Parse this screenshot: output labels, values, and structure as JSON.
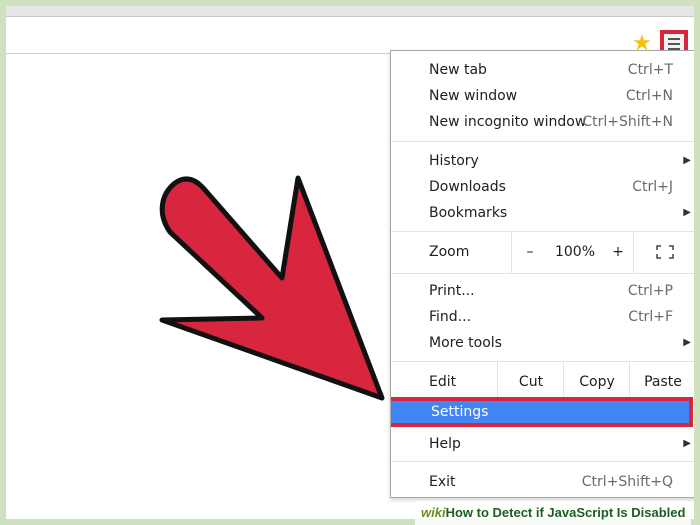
{
  "menu": {
    "group1": [
      {
        "label": "New tab",
        "shortcut": "Ctrl+T"
      },
      {
        "label": "New window",
        "shortcut": "Ctrl+N"
      },
      {
        "label": "New incognito window",
        "shortcut": "Ctrl+Shift+N"
      }
    ],
    "group2": [
      {
        "label": "History",
        "has_submenu": true
      },
      {
        "label": "Downloads",
        "shortcut": "Ctrl+J"
      },
      {
        "label": "Bookmarks",
        "has_submenu": true
      }
    ],
    "zoom": {
      "label": "Zoom",
      "minus": "–",
      "value": "100%",
      "plus": "+",
      "fullscreen_icon": "fullscreen-icon"
    },
    "group3": [
      {
        "label": "Print...",
        "shortcut": "Ctrl+P"
      },
      {
        "label": "Find...",
        "shortcut": "Ctrl+F"
      },
      {
        "label": "More tools",
        "has_submenu": true
      }
    ],
    "edit": {
      "label": "Edit",
      "cut": "Cut",
      "copy": "Copy",
      "paste": "Paste"
    },
    "settings": {
      "label": "Settings"
    },
    "help": {
      "label": "Help",
      "has_submenu": true
    },
    "exit": {
      "label": "Exit",
      "shortcut": "Ctrl+Shift+Q"
    }
  },
  "toolbar": {
    "star_icon": "bookmark-star-icon",
    "menu_icon": "hamburger-menu-icon"
  },
  "footer": {
    "wiki": "wiki",
    "title": "How to Detect if JavaScript Is Disabled"
  },
  "colors": {
    "highlight": "#d7263d",
    "settings_bg": "#4285f4",
    "pointer_arrow": "#d7263d"
  }
}
